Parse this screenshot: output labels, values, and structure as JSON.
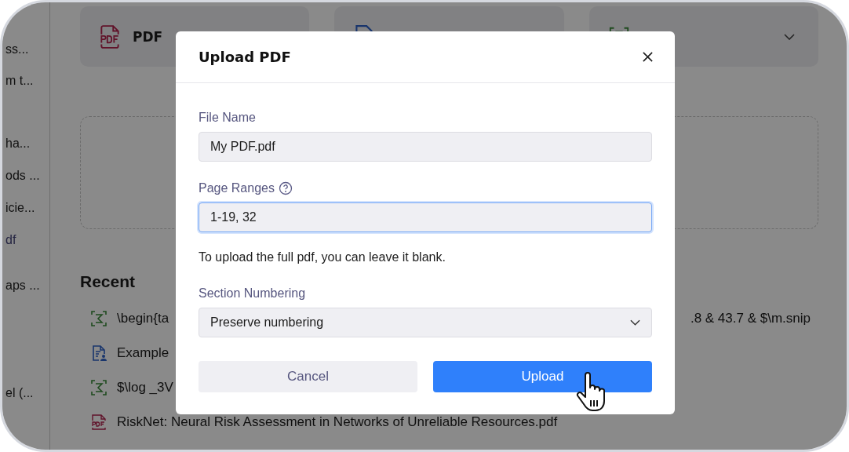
{
  "sidebar": {
    "sections": [
      [
        {
          "label": "ss...",
          "selected": false
        },
        {
          "label": "m t...",
          "selected": false
        }
      ],
      [
        {
          "label": "ha...",
          "selected": false
        },
        {
          "label": "ods ...",
          "selected": false
        },
        {
          "label": "icie...",
          "selected": false
        },
        {
          "label": "df",
          "selected": true
        },
        {
          "label": "aps ...",
          "selected": false
        }
      ],
      [
        {
          "label": "el (...",
          "selected": false
        }
      ]
    ]
  },
  "top_cards": [
    {
      "kind": "pdf",
      "label": "PDF"
    },
    {
      "kind": "document"
    },
    {
      "kind": "formula",
      "menu": true
    }
  ],
  "recent": {
    "title": "Recent",
    "items": [
      {
        "kind": "formula",
        "text": "\\begin{ta",
        "text_end": ".8 & 43.7 & $\\m.snip"
      },
      {
        "kind": "document",
        "text": "Example"
      },
      {
        "kind": "formula",
        "text": "$\\log _3V"
      },
      {
        "kind": "pdf",
        "text": "RiskNet: Neural Risk Assessment in Networks of Unreliable Resources.pdf"
      }
    ]
  },
  "dialog": {
    "title": "Upload PDF",
    "fields": [
      {
        "kind": "text",
        "label": "File Name",
        "value": "My PDF.pdf",
        "focused": false,
        "help": false
      },
      {
        "kind": "text",
        "label": "Page Ranges",
        "value": "1-19, 32",
        "focused": true,
        "help": true
      },
      {
        "kind": "note",
        "text": "To upload the full pdf, you can leave it blank."
      },
      {
        "kind": "select",
        "label": "Section Numbering",
        "value": "Preserve numbering",
        "help": false
      }
    ],
    "buttons": [
      {
        "kind": "secondary",
        "label": "Cancel",
        "hovered": false
      },
      {
        "kind": "primary",
        "label": "Upload",
        "hovered": true
      }
    ]
  }
}
